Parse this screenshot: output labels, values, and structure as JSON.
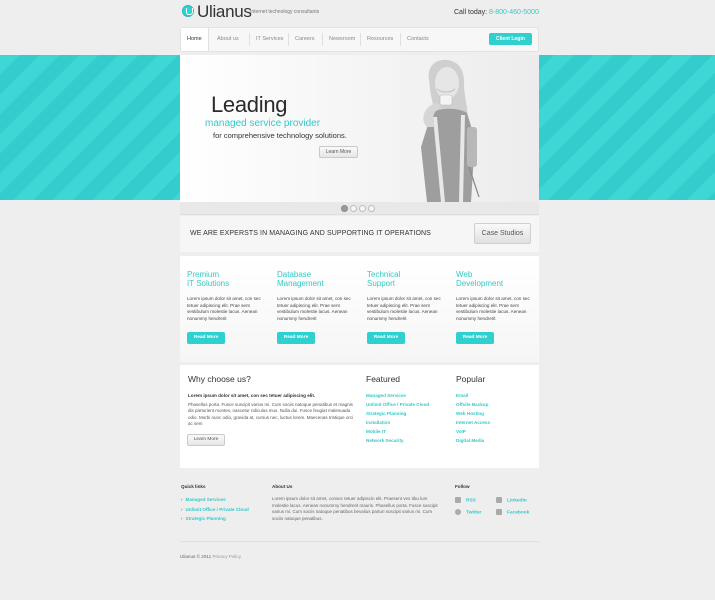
{
  "header": {
    "logo": "Ulianus",
    "tagline": "Internet technology consultants",
    "call_label": "Call today:",
    "phone": "8-800-460-5000"
  },
  "nav": {
    "items": [
      "Home",
      "About us",
      "IT Services",
      "Careers",
      "Newsroom",
      "Resources",
      "Contacts"
    ],
    "client_login": "Client Login"
  },
  "hero": {
    "title": "Leading",
    "subtitle": "managed service provider",
    "line3": "for comprehensive technology solutions.",
    "button": "Learn More"
  },
  "slider": {
    "active_index": 0,
    "count": 4
  },
  "promo": {
    "text": "WE ARE EXPERSTS IN MANAGING AND SUPPORTING IT OPERATIONS",
    "button": "Case Studios"
  },
  "services": [
    {
      "title1": "Premium",
      "title2": "IT Solutions",
      "body": "Lorem ipsum dolor sit amet, con sec tetuer adipiscing elit. Prae sent vestibulum molestie lacus. Aenean nonummy hendrerit",
      "button": "Read More"
    },
    {
      "title1": "Database",
      "title2": "Management",
      "body": "Lorem ipsum dolor sit amet, con sec tetuer adipiscing elit. Prae sent vestibulum molestie lacus. Aenean nonummy hendrerit",
      "button": "Read More"
    },
    {
      "title1": "Technical",
      "title2": "Support",
      "body": "Lorem ipsum dolor sit amet, con sec tetuer adipiscing elit. Prae sent vestibulum molestie lacus. Aenean nonummy hendrerit",
      "button": "Read More"
    },
    {
      "title1": "Web",
      "title2": "Development",
      "body": "Lorem ipsum dolor sit amet, con sec tetuer adipiscing elit. Prae sent vestibulum molestie lacus. Aenean nonummy hendrerit",
      "button": "Read More"
    }
  ],
  "why": {
    "heading": "Why choose us?",
    "bold": "Lorem ipsum dolor sit amet, con sec tetuer adipiscing elit.",
    "body": "Phasellus porta. Fusce suscipit varius mi. Cum sociis natoque penatibus et magnis dis parturient montes, nascetur ridiculus mus. Nulla dui. Fusce feugiat malesuada odio. Morbi nunc odio, gravida at, cursus nec, luctus lorem. Maecenas tristique orci ac sem",
    "button": "Learn More"
  },
  "featured": {
    "heading": "Featured",
    "items": [
      "Managed Services",
      "Unlimit Office / Private Cloud",
      "Strategic Planning",
      "Installation",
      "Mobile IT",
      "Network Security"
    ]
  },
  "popular": {
    "heading": "Popular",
    "items": [
      "Email",
      "Offsite Backup",
      "Web Hosting",
      "Internet Access",
      "VoIP",
      "Digital Media"
    ]
  },
  "footer": {
    "quick_links_heading": "Quick links",
    "quick_links": [
      "Managed Services",
      "Unlimit Office / Private Cloud",
      "Strategic Planning"
    ],
    "about_heading": "About Us",
    "about_body": "Lorem ipsum dolor sit amet, consec tetuer adipiscin elit. Praesent ves tibu lum molestie lacus. Aenean nonummy hendrerit mauris. Phasellus porta. Fusce suscipit varius mi. Cum sociis natoque penatibus bevalius parturi suscipit varius mi. Cum sociis natoque penatibus.",
    "follow_heading": "Follow",
    "follow": [
      "RSS",
      "LinkedIn",
      "Twitter",
      "Facebook"
    ],
    "copyright_name": "Ulianus",
    "copyright_year": "© 2011",
    "privacy": "Privacy Policy"
  }
}
